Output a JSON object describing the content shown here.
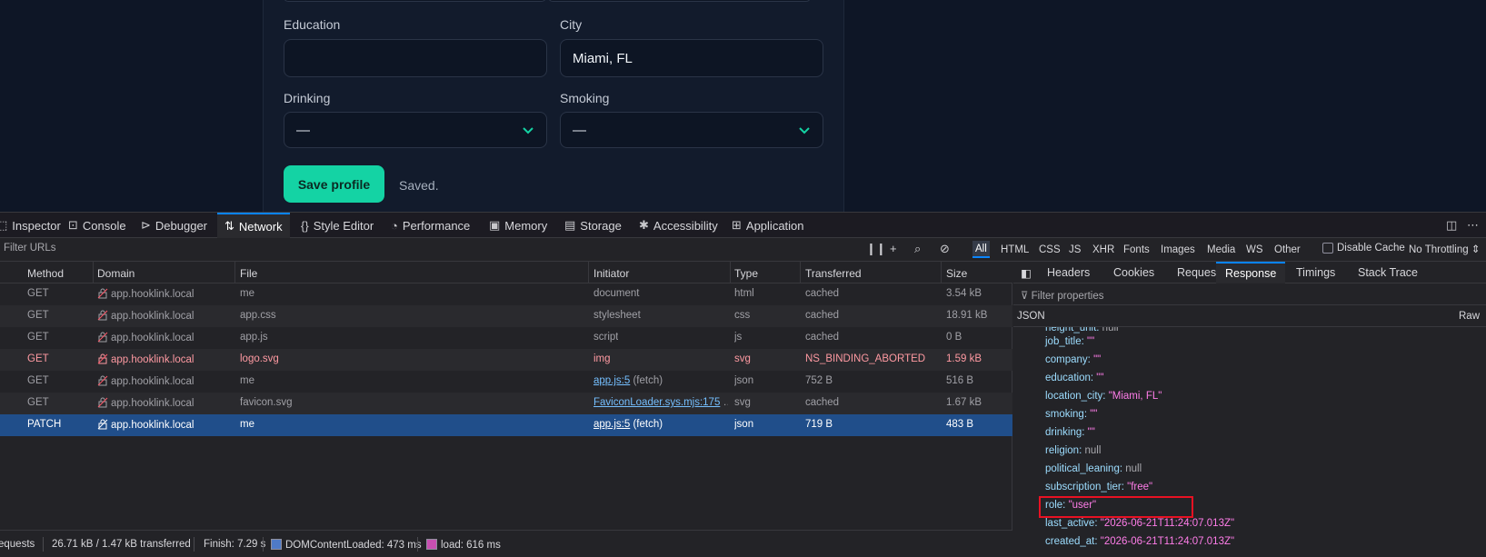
{
  "app": {
    "fields": {
      "education_label": "Education",
      "education_value": "",
      "city_label": "City",
      "city_value": "Miami, FL",
      "drinking_label": "Drinking",
      "drinking_value": "—",
      "smoking_label": "Smoking",
      "smoking_value": "—"
    },
    "save_label": "Save profile",
    "saved_msg": "Saved."
  },
  "devtools": {
    "tabs": [
      {
        "label": "Inspector",
        "icon": "inspector-icon"
      },
      {
        "label": "Console",
        "icon": "console-icon"
      },
      {
        "label": "Debugger",
        "icon": "debugger-icon"
      },
      {
        "label": "Network",
        "icon": "network-icon"
      },
      {
        "label": "Style Editor",
        "icon": "braces-icon"
      },
      {
        "label": "Performance",
        "icon": "gauge-icon"
      },
      {
        "label": "Memory",
        "icon": "chip-icon"
      },
      {
        "label": "Storage",
        "icon": "storage-icon"
      },
      {
        "label": "Accessibility",
        "icon": "accessibility-icon"
      },
      {
        "label": "Application",
        "icon": "grid-icon"
      }
    ],
    "filter_placeholder": "Filter URLs",
    "type_filters": [
      "All",
      "HTML",
      "CSS",
      "JS",
      "XHR",
      "Fonts",
      "Images",
      "Media",
      "WS",
      "Other"
    ],
    "disable_cache": "Disable Cache",
    "throttling": "No Throttling",
    "columns": [
      "Method",
      "Domain",
      "File",
      "Initiator",
      "Type",
      "Transferred",
      "Size"
    ],
    "requests": [
      {
        "method": "GET",
        "domain": "app.hooklink.local",
        "file": "me",
        "initiator": "document",
        "initiator_link": "",
        "type": "html",
        "transferred": "cached",
        "size": "3.54 kB"
      },
      {
        "method": "GET",
        "domain": "app.hooklink.local",
        "file": "app.css",
        "initiator": "stylesheet",
        "initiator_link": "",
        "type": "css",
        "transferred": "cached",
        "size": "18.91 kB"
      },
      {
        "method": "GET",
        "domain": "app.hooklink.local",
        "file": "app.js",
        "initiator": "script",
        "initiator_link": "",
        "type": "js",
        "transferred": "cached",
        "size": "0 B"
      },
      {
        "method": "GET",
        "domain": "app.hooklink.local",
        "file": "logo.svg",
        "initiator": "img",
        "initiator_link": "",
        "type": "svg",
        "transferred": "NS_BINDING_ABORTED",
        "size": "1.59 kB"
      },
      {
        "method": "GET",
        "domain": "app.hooklink.local",
        "file": "me",
        "initiator": " (fetch)",
        "initiator_link": "app.js:5",
        "type": "json",
        "transferred": "752 B",
        "size": "516 B"
      },
      {
        "method": "GET",
        "domain": "app.hooklink.local",
        "file": "favicon.svg",
        "initiator": " …",
        "initiator_link": "FaviconLoader.sys.mjs:175",
        "type": "svg",
        "transferred": "cached",
        "size": "1.67 kB"
      },
      {
        "method": "PATCH",
        "domain": "app.hooklink.local",
        "file": "me",
        "initiator": " (fetch)",
        "initiator_link": "app.js:5",
        "type": "json",
        "transferred": "719 B",
        "size": "483 B"
      }
    ],
    "status": {
      "requests": "equests",
      "transferred": "26.71 kB / 1.47 kB transferred",
      "finish": "Finish: 7.29 s",
      "dcl": "DOMContentLoaded: 473 ms",
      "load": "load: 616 ms"
    },
    "panel_tabs": [
      "Headers",
      "Cookies",
      "Request",
      "Response",
      "Timings",
      "Stack Trace"
    ],
    "filter_properties": "Filter properties",
    "json_label": "JSON",
    "raw_label": "Raw",
    "json_rows": [
      {
        "key": "job_title",
        "value": "\"\"",
        "kind": "s"
      },
      {
        "key": "company",
        "value": "\"\"",
        "kind": "s"
      },
      {
        "key": "education",
        "value": "\"\"",
        "kind": "s"
      },
      {
        "key": "location_city",
        "value": "\"Miami, FL\"",
        "kind": "s"
      },
      {
        "key": "smoking",
        "value": "\"\"",
        "kind": "s"
      },
      {
        "key": "drinking",
        "value": "\"\"",
        "kind": "s"
      },
      {
        "key": "religion",
        "value": "null",
        "kind": "n"
      },
      {
        "key": "political_leaning",
        "value": "null",
        "kind": "n"
      },
      {
        "key": "subscription_tier",
        "value": "\"free\"",
        "kind": "s"
      },
      {
        "key": "role",
        "value": "\"user\"",
        "kind": "s"
      },
      {
        "key": "last_active",
        "value": "\"2026-06-21T11:24:07.013Z\"",
        "kind": "s"
      },
      {
        "key": "created_at",
        "value": "\"2026-06-21T11:24:07.013Z\"",
        "kind": "s"
      }
    ]
  }
}
